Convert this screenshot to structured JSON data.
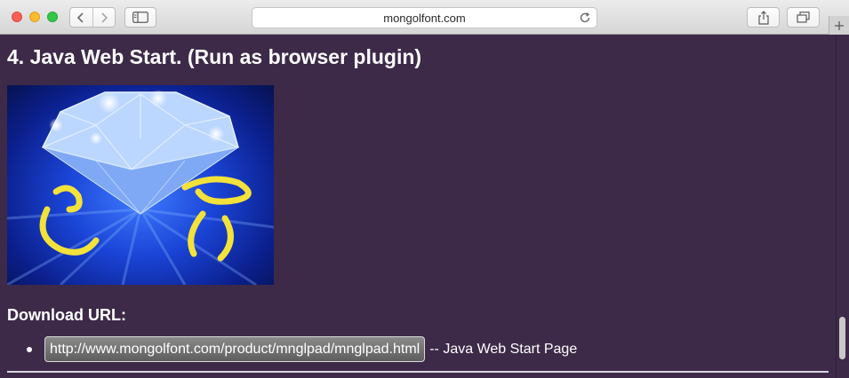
{
  "browser": {
    "address": "mongolfont.com",
    "icons": {
      "back": "chevron-left-icon",
      "forward": "chevron-right-icon",
      "sidebar": "sidebar-icon",
      "reload": "reload-icon",
      "share": "share-icon",
      "tabs": "tabs-overview-icon",
      "new_tab": "plus-icon"
    }
  },
  "page": {
    "heading": "4. Java Web Start. (Run as browser plugin)",
    "download_label": "Download URL:",
    "links": [
      {
        "url": "http://www.mongolfont.com/product/mnglpad/mnglpad.html",
        "suffix": "-- Java Web Start Page"
      }
    ]
  },
  "colors": {
    "page_background": "#3d2a48",
    "text": "#ffffff",
    "link_pill": "#6e6e6e"
  }
}
